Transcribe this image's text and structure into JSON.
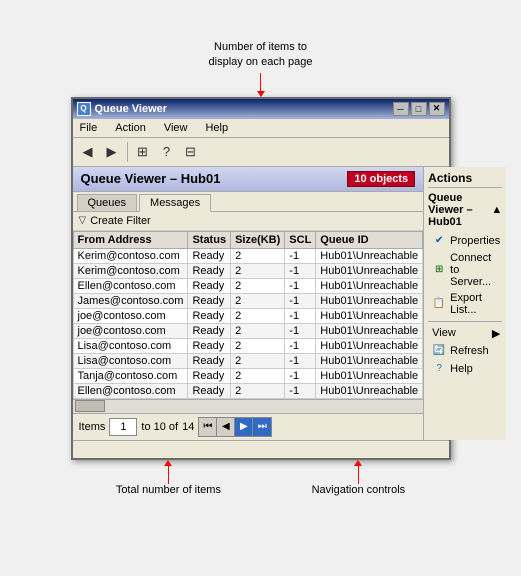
{
  "annotation_top": {
    "line1": "Number of items to",
    "line2": "display on each page"
  },
  "window": {
    "title": "Queue Viewer",
    "minimize": "─",
    "maximize": "□",
    "close": "✕"
  },
  "menubar": {
    "items": [
      "File",
      "Action",
      "View",
      "Help"
    ]
  },
  "toolbar": {
    "buttons": [
      "◀",
      "▶",
      "⊞",
      "?",
      "⊟"
    ]
  },
  "panel_header": {
    "title": "Queue Viewer – Hub01",
    "badge": "10 objects"
  },
  "tabs": [
    {
      "label": "Queues",
      "active": false
    },
    {
      "label": "Messages",
      "active": true
    }
  ],
  "filter": {
    "label": "Create Filter"
  },
  "table": {
    "columns": [
      "From Address",
      "Status",
      "Size(KB)",
      "SCL",
      "Queue ID"
    ],
    "rows": [
      [
        "Kerim@contoso.com",
        "Ready",
        "2",
        "-1",
        "Hub01\\Unreachable"
      ],
      [
        "Kerim@contoso.com",
        "Ready",
        "2",
        "-1",
        "Hub01\\Unreachable"
      ],
      [
        "Ellen@contoso.com",
        "Ready",
        "2",
        "-1",
        "Hub01\\Unreachable"
      ],
      [
        "James@contoso.com",
        "Ready",
        "2",
        "-1",
        "Hub01\\Unreachable"
      ],
      [
        "joe@contoso.com",
        "Ready",
        "2",
        "-1",
        "Hub01\\Unreachable"
      ],
      [
        "joe@contoso.com",
        "Ready",
        "2",
        "-1",
        "Hub01\\Unreachable"
      ],
      [
        "Lisa@contoso.com",
        "Ready",
        "2",
        "-1",
        "Hub01\\Unreachable"
      ],
      [
        "Lisa@contoso.com",
        "Ready",
        "2",
        "-1",
        "Hub01\\Unreachable"
      ],
      [
        "Tanja@contoso.com",
        "Ready",
        "2",
        "-1",
        "Hub01\\Unreachable"
      ],
      [
        "Ellen@contoso.com",
        "Ready",
        "2",
        "-1",
        "Hub01\\Unreachable"
      ]
    ]
  },
  "pagination": {
    "items_label": "Items",
    "current_value": "1",
    "range_text": "to 10 of",
    "total": "14"
  },
  "nav_buttons": [
    "⏮",
    "◀",
    "▶",
    "⏭"
  ],
  "actions": {
    "title": "Actions",
    "section_title": "Queue Viewer – Hub01",
    "items": [
      {
        "label": "Properties",
        "icon": "✔",
        "icon_class": "blue"
      },
      {
        "label": "Connect to Server...",
        "icon": "⊞",
        "icon_class": "green"
      },
      {
        "label": "Export List...",
        "icon": "📋",
        "icon_class": "orange"
      },
      {
        "label": "View",
        "has_arrow": true
      },
      {
        "label": "Refresh",
        "icon": "🔄",
        "icon_class": "teal"
      },
      {
        "label": "Help",
        "icon": "?",
        "icon_class": "help"
      }
    ]
  },
  "annotation_bottom_left": "Total number of items",
  "annotation_bottom_right": "Navigation controls"
}
